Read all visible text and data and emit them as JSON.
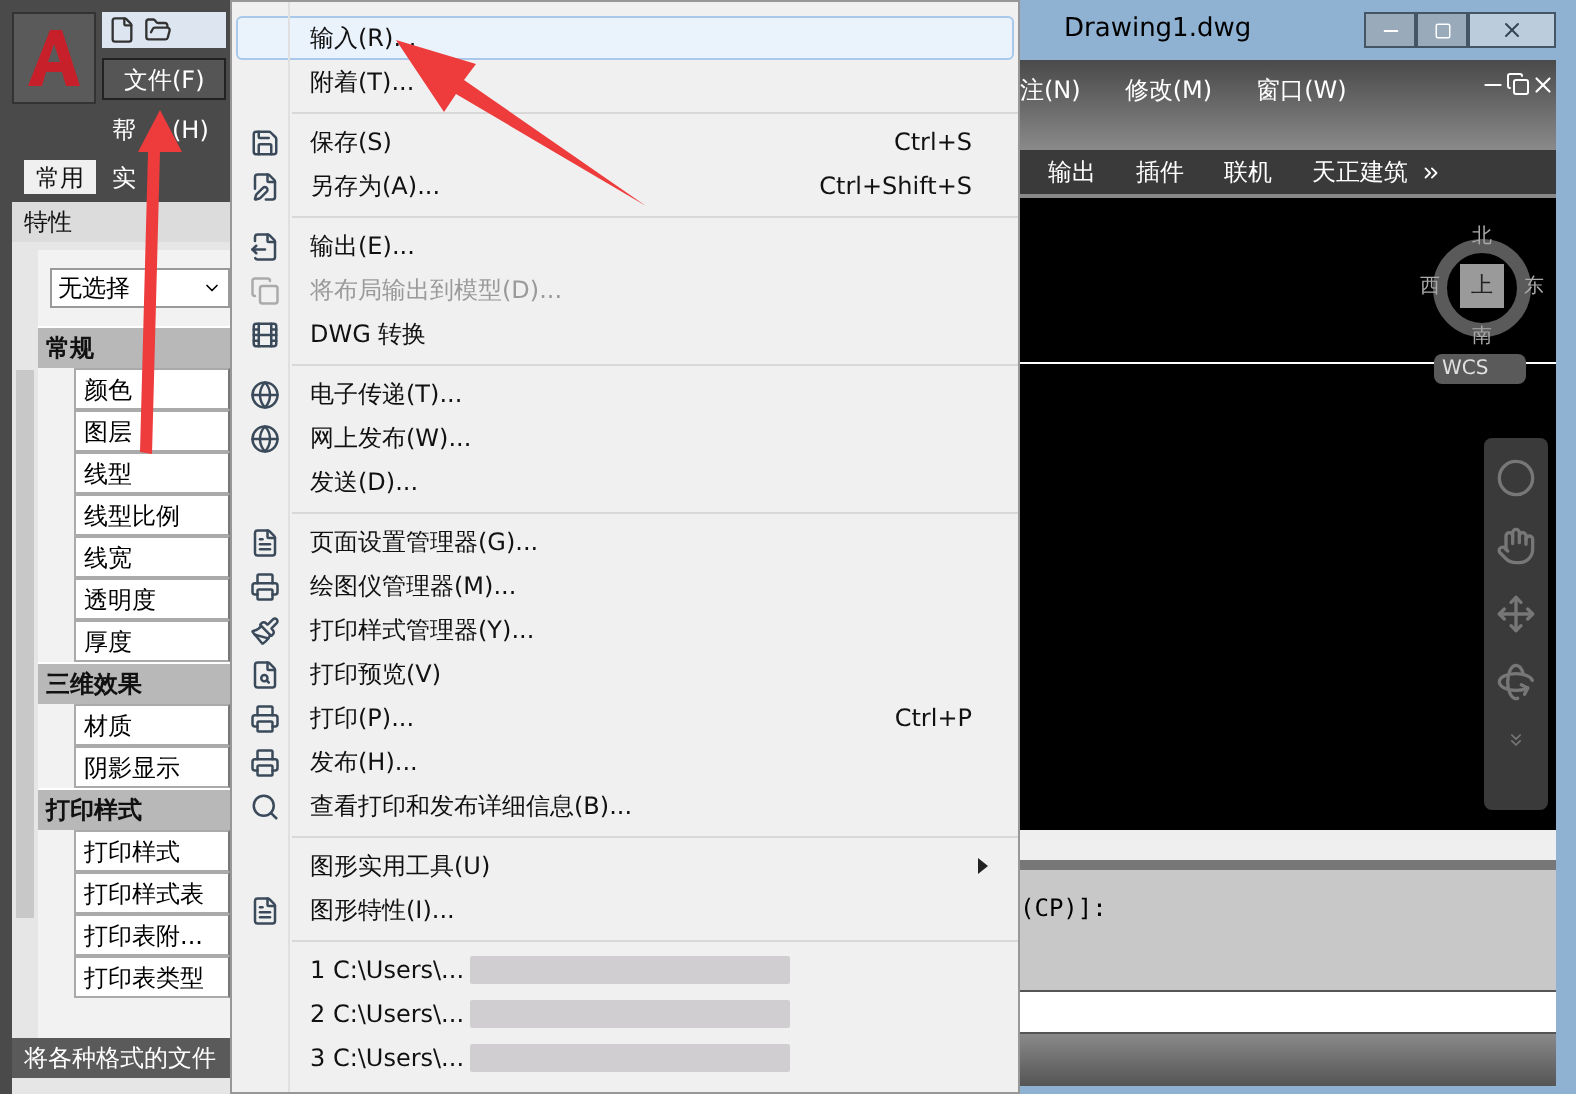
{
  "window": {
    "title": "Drawing1.dwg"
  },
  "menu_bar_left": [
    {
      "label": "文件(F)",
      "selected": true
    },
    {
      "label": "帮",
      "suffix": "(H)",
      "selected": false
    }
  ],
  "menu_bar_right": [
    {
      "label": "注(N)",
      "selected": false
    },
    {
      "label": "修改(M)",
      "selected": false
    },
    {
      "label": "窗口(W)",
      "selected": false
    }
  ],
  "ribbon_tabs_left": [
    {
      "label": "常用",
      "selected": true
    },
    {
      "label": "实",
      "selected": false
    }
  ],
  "ribbon_tabs_right": [
    {
      "label": "输出",
      "selected": false
    },
    {
      "label": "插件",
      "selected": false
    },
    {
      "label": "联机",
      "selected": false
    },
    {
      "label": "天正建筑",
      "selected": false
    }
  ],
  "properties_panel": {
    "title": "特性",
    "selection": "无选择",
    "sections": [
      {
        "title": "常规",
        "rows": [
          "颜色",
          "图层",
          "线型",
          "线型比例",
          "线宽",
          "透明度",
          "厚度"
        ]
      },
      {
        "title": "三维效果",
        "rows": [
          "材质",
          "阴影显示"
        ]
      },
      {
        "title": "打印样式",
        "rows": [
          "打印样式",
          "打印样式表",
          "打印表附...",
          "打印表类型"
        ]
      }
    ]
  },
  "status_text": "将各种格式的文件",
  "viewcube": {
    "north": "北",
    "west": "西",
    "top": "上",
    "east": "东",
    "south": "南",
    "ucs": "WCS"
  },
  "command_line": {
    "text": "(CP)]:"
  },
  "file_menu": {
    "items": [
      {
        "kind": "item",
        "label": "输入(R)...",
        "selected": true,
        "disabled": false
      },
      {
        "kind": "item",
        "label": "附着(T)...",
        "selected": false,
        "disabled": false
      },
      {
        "kind": "separator"
      },
      {
        "kind": "item",
        "label": "保存(S)",
        "shortcut": "Ctrl+S",
        "selected": false,
        "disabled": false
      },
      {
        "kind": "item",
        "label": "另存为(A)...",
        "shortcut": "Ctrl+Shift+S",
        "selected": false,
        "disabled": false
      },
      {
        "kind": "separator"
      },
      {
        "kind": "item",
        "label": "输出(E)...",
        "selected": false,
        "disabled": false
      },
      {
        "kind": "item",
        "label": "将布局输出到模型(D)...",
        "selected": false,
        "disabled": true
      },
      {
        "kind": "item",
        "label": "DWG 转换",
        "selected": false,
        "disabled": false
      },
      {
        "kind": "separator"
      },
      {
        "kind": "item",
        "label": "电子传递(T)...",
        "selected": false,
        "disabled": false
      },
      {
        "kind": "item",
        "label": "网上发布(W)...",
        "selected": false,
        "disabled": false
      },
      {
        "kind": "item",
        "label": "发送(D)...",
        "selected": false,
        "disabled": false
      },
      {
        "kind": "separator"
      },
      {
        "kind": "item",
        "label": "页面设置管理器(G)...",
        "selected": false,
        "disabled": false
      },
      {
        "kind": "item",
        "label": "绘图仪管理器(M)...",
        "selected": false,
        "disabled": false
      },
      {
        "kind": "item",
        "label": "打印样式管理器(Y)...",
        "selected": false,
        "disabled": false
      },
      {
        "kind": "item",
        "label": "打印预览(V)",
        "selected": false,
        "disabled": false
      },
      {
        "kind": "item",
        "label": "打印(P)...",
        "shortcut": "Ctrl+P",
        "selected": false,
        "disabled": false
      },
      {
        "kind": "item",
        "label": "发布(H)...",
        "selected": false,
        "disabled": false
      },
      {
        "kind": "item",
        "label": "查看打印和发布详细信息(B)...",
        "selected": false,
        "disabled": false
      },
      {
        "kind": "separator"
      },
      {
        "kind": "submenu",
        "label": "图形实用工具(U)",
        "selected": false,
        "disabled": false
      },
      {
        "kind": "item",
        "label": "图形特性(I)...",
        "selected": false,
        "disabled": false
      },
      {
        "kind": "separator"
      },
      {
        "kind": "recent",
        "label": "1 C:\\Users\\...",
        "selected": false,
        "disabled": false
      },
      {
        "kind": "recent",
        "label": "2 C:\\Users\\...",
        "selected": false,
        "disabled": false
      },
      {
        "kind": "recent",
        "label": "3 C:\\Users\\...",
        "selected": false,
        "disabled": false
      }
    ]
  }
}
